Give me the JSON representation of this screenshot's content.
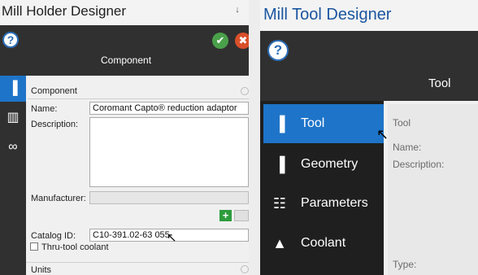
{
  "left": {
    "window_title": "Mill Holder Designer",
    "pin_glyph": " ↓",
    "help_glyph": "?",
    "ok_glyph": "✔",
    "cancel_glyph": "✖",
    "heading": "Component",
    "nav": [
      {
        "icon": "holder-icon",
        "glyph": "▐"
      },
      {
        "icon": "tool-assembly-icon",
        "glyph": "▥"
      },
      {
        "icon": "link-icon",
        "glyph": "∞"
      }
    ],
    "section_component": "Component",
    "name_label": "Name:",
    "name_value": "Coromant Capto® reduction adaptor",
    "description_label": "Description:",
    "description_value": "",
    "manufacturer_label": "Manufacturer:",
    "manufacturer_value": "",
    "add_glyph": "+",
    "catalog_label": "Catalog ID:",
    "catalog_value": "C10-391.02-63 055",
    "thru_coolant_label": "Thru-tool coolant",
    "thru_coolant_checked": false,
    "units_label": "Units"
  },
  "right": {
    "window_title": "Mill Tool Designer",
    "help_glyph": "?",
    "heading": "Tool",
    "nav": [
      {
        "label": "Tool",
        "icon": "endmill-icon",
        "glyph": "▐",
        "active": true
      },
      {
        "label": "Geometry",
        "icon": "geometry-icon",
        "glyph": "▐",
        "active": false
      },
      {
        "label": "Parameters",
        "icon": "parameters-icon",
        "glyph": "☷",
        "active": false
      },
      {
        "label": "Coolant",
        "icon": "coolant-drop-icon",
        "glyph": "▲",
        "active": false
      }
    ],
    "section_tool": "Tool",
    "name_label": "Name:",
    "description_label": "Description:",
    "type_label": "Type:",
    "cursor_glyph": "↖"
  },
  "colors": {
    "accent": "#1e74c8",
    "toolbar_dark": "#303030",
    "title_blue": "#1c56a0",
    "ok_green": "#4aa04a",
    "cancel_red": "#d9502b"
  }
}
